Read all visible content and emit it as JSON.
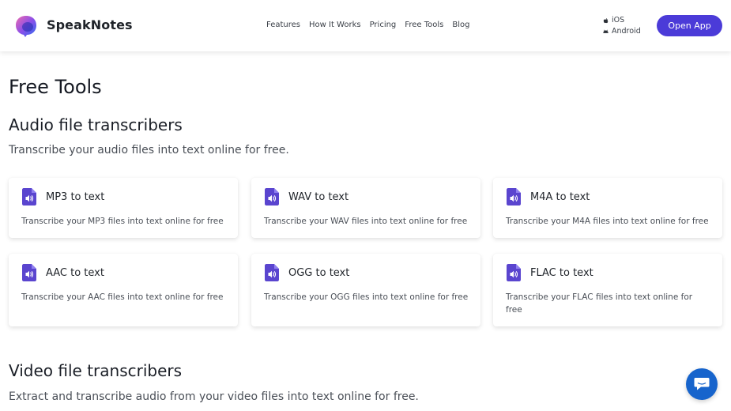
{
  "header": {
    "brand": "SpeakNotes",
    "nav": [
      "Features",
      "How It Works",
      "Pricing",
      "Free Tools",
      "Blog"
    ],
    "platforms": [
      {
        "icon": "apple-icon",
        "label": "iOS"
      },
      {
        "icon": "android-icon",
        "label": "Android"
      }
    ],
    "open_app_label": "Open App"
  },
  "page_title": "Free Tools",
  "audio_section": {
    "title": "Audio file transcribers",
    "description": "Transcribe your audio files into text online for free.",
    "cards": [
      {
        "title": "MP3 to text",
        "desc": "Transcribe your MP3 files into text online for free"
      },
      {
        "title": "WAV to text",
        "desc": "Transcribe your WAV files into text online for free"
      },
      {
        "title": "M4A to text",
        "desc": "Transcribe your M4A files into text online for free"
      },
      {
        "title": "AAC to text",
        "desc": "Transcribe your AAC files into text online for free"
      },
      {
        "title": "OGG to text",
        "desc": "Transcribe your OGG files into text online for free"
      },
      {
        "title": "FLAC to text",
        "desc": "Transcribe your FLAC files into text online for free"
      }
    ]
  },
  "video_section": {
    "title": "Video file transcribers",
    "description": "Extract and transcribe audio from your video files into text online for free."
  },
  "colors": {
    "accent": "#4b3bd8",
    "icon": "#5a45cf",
    "chat": "#1764cc"
  }
}
